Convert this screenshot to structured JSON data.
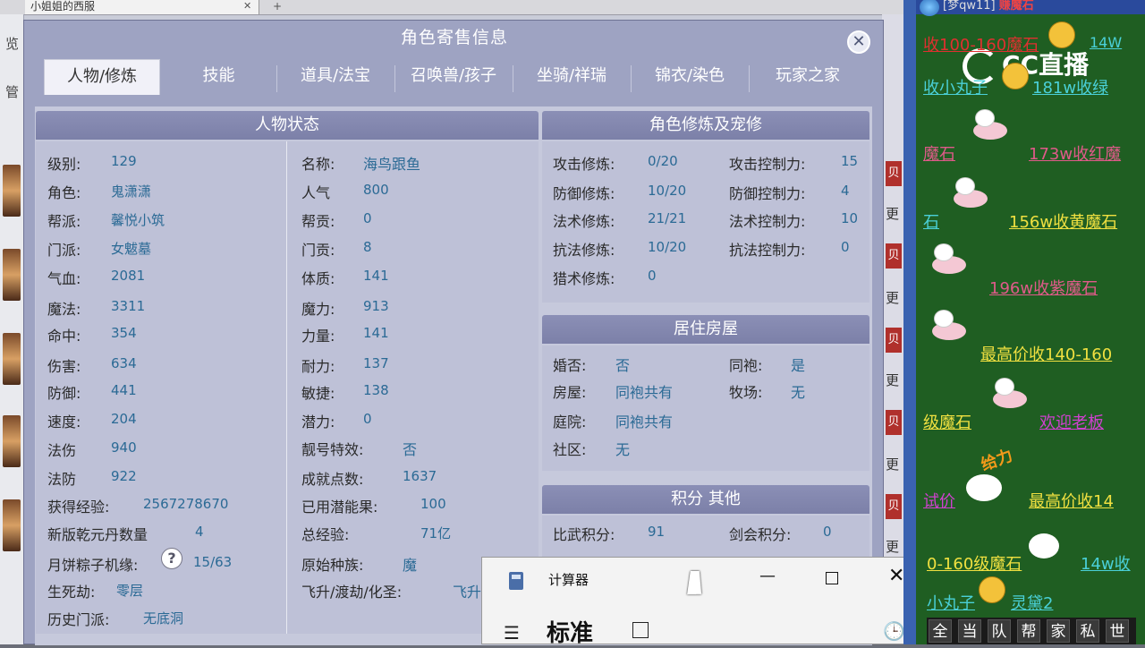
{
  "browser": {
    "tab_title": "小姐姐的西服",
    "left_chars": [
      "览",
      "管"
    ],
    "right_chars": [
      "更",
      "更",
      "更",
      "更",
      "更"
    ],
    "right_red": [
      "贝",
      "贝",
      "贝",
      "贝",
      "贝"
    ]
  },
  "dialog": {
    "title": "角色寄售信息",
    "close": "✕",
    "tabs": [
      "人物/修炼",
      "技能",
      "道具/法宝",
      "召唤兽/孩子",
      "坐骑/祥瑞",
      "锦衣/染色",
      "玩家之家"
    ],
    "active_tab": 0
  },
  "status": {
    "header": "人物状态",
    "col1": [
      {
        "label": "级别:",
        "value": "129"
      },
      {
        "label": "角色:",
        "value": "鬼潇潇"
      },
      {
        "label": "帮派:",
        "value": "馨悦小筑"
      },
      {
        "label": "门派:",
        "value": "女魃墓"
      },
      {
        "label": "气血:",
        "value": "2081"
      },
      {
        "label": "魔法:",
        "value": "3311"
      },
      {
        "label": "命中:",
        "value": "354"
      },
      {
        "label": "伤害:",
        "value": "634"
      },
      {
        "label": "防御:",
        "value": "441"
      },
      {
        "label": "速度:",
        "value": "204"
      },
      {
        "label": "法伤",
        "value": "940"
      },
      {
        "label": "法防",
        "value": "922"
      },
      {
        "label": "获得经验:",
        "value": "2567278670"
      },
      {
        "label": "新版乾元丹数量",
        "value": "4"
      },
      {
        "label": "月饼粽子机缘:",
        "value": "15/63"
      },
      {
        "label": "生死劫:",
        "value": "零层"
      },
      {
        "label": "历史门派:",
        "value": "无底洞"
      }
    ],
    "col2": [
      {
        "label": "名称:",
        "value": "海鸟跟鱼"
      },
      {
        "label": "人气",
        "value": "800"
      },
      {
        "label": "帮贡:",
        "value": "0"
      },
      {
        "label": "门贡:",
        "value": "8"
      },
      {
        "label": "体质:",
        "value": "141"
      },
      {
        "label": "魔力:",
        "value": "913"
      },
      {
        "label": "力量:",
        "value": "141"
      },
      {
        "label": "耐力:",
        "value": "137"
      },
      {
        "label": "敏捷:",
        "value": "138"
      },
      {
        "label": "潜力:",
        "value": "0"
      },
      {
        "label": "靓号特效:",
        "value": "否"
      },
      {
        "label": "成就点数:",
        "value": "1637"
      },
      {
        "label": "已用潜能果:",
        "value": "100"
      },
      {
        "label": "总经验:",
        "value": "71亿"
      },
      {
        "label": "原始种族:",
        "value": "魔"
      },
      {
        "label": "飞升/渡劫/化圣:",
        "value": "飞升"
      }
    ],
    "help_icon": "?"
  },
  "cultivation": {
    "header": "角色修炼及宠修",
    "col1": [
      {
        "label": "攻击修炼:",
        "value": "0/20"
      },
      {
        "label": "防御修炼:",
        "value": "10/20"
      },
      {
        "label": "法术修炼:",
        "value": "21/21"
      },
      {
        "label": "抗法修炼:",
        "value": "10/20"
      },
      {
        "label": "猎术修炼:",
        "value": "0"
      }
    ],
    "col2": [
      {
        "label": "攻击控制力:",
        "value": "15"
      },
      {
        "label": "防御控制力:",
        "value": "4"
      },
      {
        "label": "法术控制力:",
        "value": "10"
      },
      {
        "label": "抗法控制力:",
        "value": "0"
      }
    ]
  },
  "housing": {
    "header": "居住房屋",
    "col1": [
      {
        "label": "婚否:",
        "value": "否"
      },
      {
        "label": "房屋:",
        "value": "同袍共有"
      },
      {
        "label": "庭院:",
        "value": "同袍共有"
      },
      {
        "label": "社区:",
        "value": "无"
      }
    ],
    "col2": [
      {
        "label": "同袍:",
        "value": "是"
      },
      {
        "label": "牧场:",
        "value": "无"
      }
    ]
  },
  "points": {
    "header": "积分 其他",
    "col1": [
      {
        "label": "比武积分:",
        "value": "91"
      }
    ],
    "col2": [
      {
        "label": "剑会积分:",
        "value": "0"
      }
    ]
  },
  "calculator": {
    "title": "计算器",
    "minimize": "—",
    "close": "✕",
    "menu": "☰",
    "mode": "标准",
    "history": "🕒"
  },
  "chat": {
    "topbar_user": "[梦qw11]",
    "topbar_tail": "赚魔石",
    "logo": "CC直播",
    "lines": [
      {
        "text": "收100-160魔石",
        "color": "#e03030"
      },
      {
        "text": "14W",
        "color": "#4ad0d8"
      },
      {
        "text": "收小丸子",
        "color": "#4ad0d8"
      },
      {
        "text": "181w收绿",
        "color": "#4ad0d8"
      },
      {
        "text": "魔石",
        "color": "#e05a8a"
      },
      {
        "text": "173w收红魔",
        "color": "#e05a8a"
      },
      {
        "text": "石",
        "color": "#4ad0d8"
      },
      {
        "text": "156w收黄魔石",
        "color": "#f0e040"
      },
      {
        "text": "196w收紫魔石",
        "color": "#e05a8a"
      },
      {
        "text": "最高价收140-160",
        "color": "#f0e040"
      },
      {
        "text": "级魔石",
        "color": "#f0e040"
      },
      {
        "text": "欢迎老板",
        "color": "#d040d0"
      },
      {
        "text": "试价",
        "color": "#d040d0"
      },
      {
        "text": "最高价收14",
        "color": "#f0e040"
      },
      {
        "text": "0-160级魔石",
        "color": "#f0e040"
      },
      {
        "text": "14w收",
        "color": "#4ad0d8"
      },
      {
        "text": "小丸子",
        "color": "#4ad0d8"
      },
      {
        "text": "灵黛2",
        "color": "#4ad0d8"
      }
    ],
    "gift_text": "给力",
    "bottom_buttons": [
      "全",
      "当",
      "队",
      "帮",
      "家",
      "私",
      "世"
    ]
  }
}
